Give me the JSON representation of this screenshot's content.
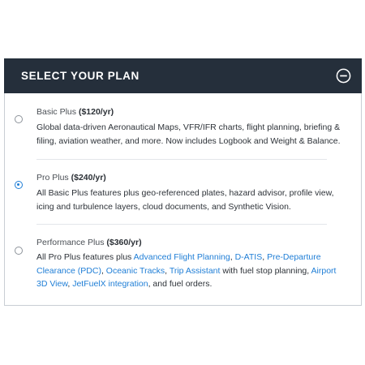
{
  "panel": {
    "title": "SELECT YOUR PLAN",
    "collapse_icon": "minus-circle-icon"
  },
  "plans": [
    {
      "name": "Basic Plus",
      "price": "($120/yr)",
      "selected": false,
      "description_parts": [
        "Global data-driven Aeronautical Maps, VFR/IFR charts, flight planning, briefing & filing, aviation weather, and more. Now includes Logbook and Weight & Balance."
      ]
    },
    {
      "name": "Pro Plus",
      "price": "($240/yr)",
      "selected": true,
      "description_parts": [
        "All Basic Plus features plus geo-referenced plates, hazard advisor, profile view, icing and turbulence layers, cloud documents, and Synthetic Vision."
      ]
    },
    {
      "name": "Performance Plus",
      "price": "($360/yr)",
      "selected": false,
      "description_intro": "All Pro Plus features plus ",
      "links": {
        "advanced_flight_planning": "Advanced Flight Planning",
        "datis": "D-ATIS",
        "pdc": "Pre-Departure Clearance (PDC)",
        "oceanic_tracks": "Oceanic Tracks",
        "trip_assistant": "Trip Assistant",
        "airport_3d_view": "Airport 3D View",
        "jetfuelx": "JetFuelX integration"
      },
      "sep_comma": ", ",
      "sep_trip": " with fuel stop planning, ",
      "description_end": ", and fuel orders."
    }
  ],
  "colors": {
    "header_bg": "#252f3b",
    "accent": "#1f7ed6"
  }
}
